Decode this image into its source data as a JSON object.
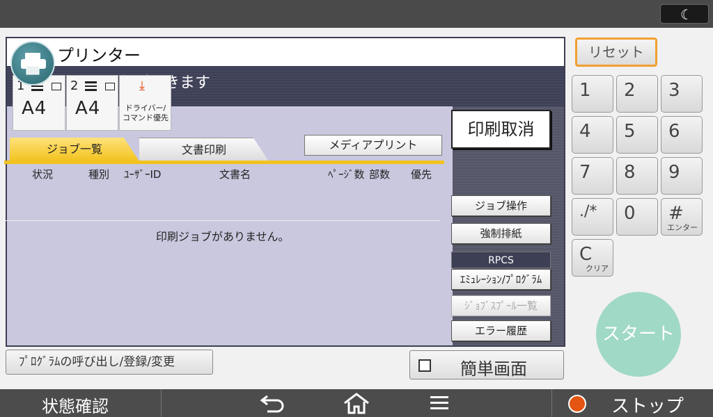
{
  "topbar": {
    "energy_icon": "moon-icon"
  },
  "panel": {
    "title": "プリンター",
    "status": "印刷できます",
    "trays": [
      {
        "number": "1",
        "size": "A4"
      },
      {
        "number": "2",
        "size": "A4"
      }
    ],
    "driver_priority": {
      "line1": "ドライバー/",
      "line2": "コマンド優先"
    },
    "tabs": [
      "ジョブ一覧",
      "文書印刷"
    ],
    "media_print": "メディアプリント",
    "columns": [
      "状況",
      "種別",
      "ﾕｰｻﾞｰID",
      "文書名",
      "ﾍﾟｰｼﾞ数",
      "部数",
      "優先"
    ],
    "empty_message": "印刷ジョブがありません。"
  },
  "side": {
    "cancel_print": "印刷取消",
    "job_operation": "ジョブ操作",
    "force_eject": "強制排紙",
    "rpcs": "RPCS",
    "emulation": "ｴﾐｭﾚｰｼｮﾝ/ﾌﾟﾛｸﾞﾗﾑ",
    "spool_list": "ｼﾞｮﾌﾞｽﾌﾟｰﾙ一覧",
    "error_history": "エラー履歴"
  },
  "bottom": {
    "program_button": "ﾌﾟﾛｸﾞﾗﾑの呼び出し/登録/変更",
    "simple_screen": "簡単画面"
  },
  "keypad": {
    "reset": "リセット",
    "keys": [
      {
        "label": "1",
        "sub": ""
      },
      {
        "label": "2",
        "sub": ""
      },
      {
        "label": "3",
        "sub": ""
      },
      {
        "label": "4",
        "sub": ""
      },
      {
        "label": "5",
        "sub": ""
      },
      {
        "label": "6",
        "sub": ""
      },
      {
        "label": "7",
        "sub": ""
      },
      {
        "label": "8",
        "sub": ""
      },
      {
        "label": "9",
        "sub": ""
      },
      {
        "label": "./*",
        "sub": ""
      },
      {
        "label": "0",
        "sub": ""
      },
      {
        "label": "#",
        "sub": "エンター"
      },
      {
        "label": "C",
        "sub": "クリア"
      }
    ],
    "start": "スタート"
  },
  "bottombar": {
    "status_check": "状態確認",
    "back_icon": "back-arrow-icon",
    "home_icon": "home-icon",
    "menu_icon": "menu-icon",
    "stop": "ストップ"
  },
  "colors": {
    "accent_tab": "#f2c21e",
    "reset_border": "#f0a030",
    "start": "#a0d9c6",
    "stop": "#e45512",
    "panel_bg": "#c9c8df"
  }
}
